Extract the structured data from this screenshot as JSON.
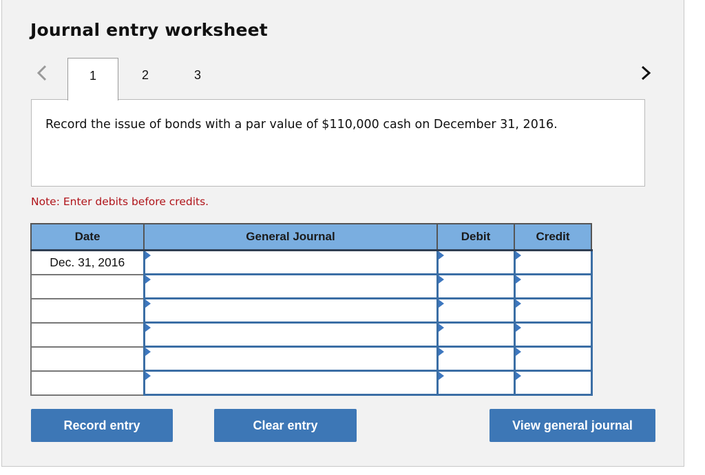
{
  "title": "Journal entry worksheet",
  "nav": {
    "prev_icon": "chevron-left-icon",
    "next_icon": "chevron-right-icon"
  },
  "tabs": [
    {
      "label": "1",
      "active": true
    },
    {
      "label": "2",
      "active": false
    },
    {
      "label": "3",
      "active": false
    }
  ],
  "description": "Record the issue of bonds with a par value of $110,000 cash on December 31, 2016.",
  "note": "Note: Enter debits before credits.",
  "table": {
    "headers": [
      "Date",
      "General Journal",
      "Debit",
      "Credit"
    ],
    "rows": [
      {
        "date": "Dec. 31, 2016",
        "account": "",
        "debit": "",
        "credit": ""
      },
      {
        "date": "",
        "account": "",
        "debit": "",
        "credit": ""
      },
      {
        "date": "",
        "account": "",
        "debit": "",
        "credit": ""
      },
      {
        "date": "",
        "account": "",
        "debit": "",
        "credit": ""
      },
      {
        "date": "",
        "account": "",
        "debit": "",
        "credit": ""
      },
      {
        "date": "",
        "account": "",
        "debit": "",
        "credit": ""
      }
    ]
  },
  "buttons": {
    "record": "Record entry",
    "clear": "Clear entry",
    "view": "View general journal"
  },
  "colors": {
    "header_bg": "#7aaee0",
    "button_bg": "#3d77b6",
    "note_text": "#b0141a",
    "input_border": "#3b6ea5"
  }
}
